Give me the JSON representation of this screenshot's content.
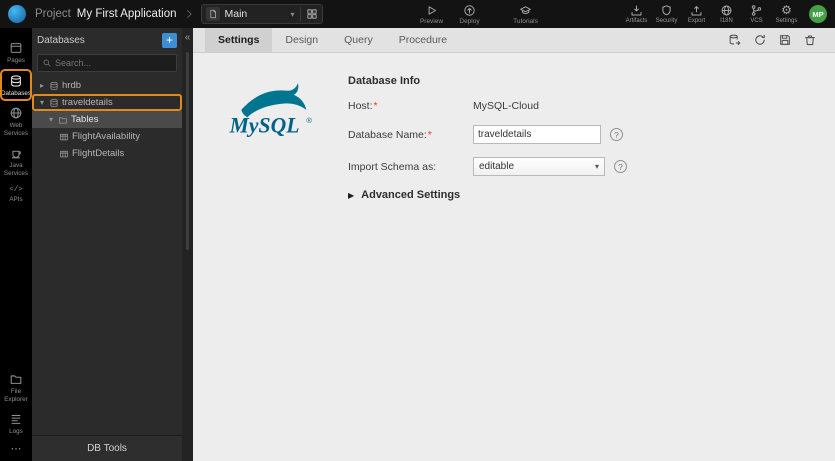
{
  "topbar": {
    "project_prefix": "Project",
    "project_name": "My First Application",
    "page_selector": "Main",
    "preview_label": "Preview",
    "deploy_label": "Deploy",
    "tutorials_label": "Tutorials",
    "tools": [
      {
        "label": "Artifacts"
      },
      {
        "label": "Security"
      },
      {
        "label": "Export"
      },
      {
        "label": "I18N"
      },
      {
        "label": "VCS"
      },
      {
        "label": "Settings"
      }
    ],
    "avatar_initials": "MP"
  },
  "rail": {
    "items": [
      {
        "label": "Pages"
      },
      {
        "label": "Databases"
      },
      {
        "label": "Web Services"
      },
      {
        "label": "Java Services"
      },
      {
        "label": "APIs"
      }
    ],
    "bottom_items": [
      {
        "label": "File Explorer"
      },
      {
        "label": "Logs"
      }
    ]
  },
  "panel": {
    "title": "Databases",
    "add_button": "+",
    "search_placeholder": "Search...",
    "tree": [
      {
        "label": "hrdb"
      },
      {
        "label": "traveldetails"
      },
      {
        "label": "Tables"
      },
      {
        "label": "FlightAvailability"
      },
      {
        "label": "FlightDetails"
      }
    ],
    "db_tools": "DB Tools"
  },
  "tabs": [
    {
      "label": "Settings"
    },
    {
      "label": "Design"
    },
    {
      "label": "Query"
    },
    {
      "label": "Procedure"
    }
  ],
  "editor": {
    "heading": "Database Info",
    "host_label": "Host:",
    "host_required": "*",
    "host_value": "MySQL-Cloud",
    "dbname_label": "Database Name:",
    "dbname_required": "*",
    "dbname_value": "traveldetails",
    "import_label": "Import Schema as:",
    "import_value": "editable",
    "advanced_label": "Advanced Settings",
    "help_glyph": "?"
  },
  "mysql_logo": {
    "text": "MySQL",
    "registered": "®"
  },
  "icons": {
    "collapse": "«",
    "caret_right": "▸",
    "caret_down": "▾",
    "select_caret": "▼",
    "advanced_caret": "▶",
    "gear": "⚙",
    "more": "⋯",
    "apis": "</>"
  },
  "colors": {
    "accent_blue": "#3d8fd1",
    "annotation_orange": "#e08a1e",
    "avatar_green": "#43a047",
    "mysql_teal": "#00758f",
    "mysql_blue": "#00618a"
  }
}
